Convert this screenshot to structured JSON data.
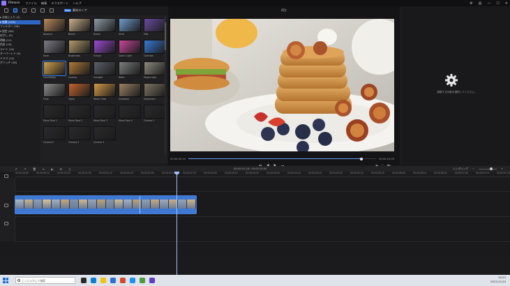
{
  "window": {
    "app_name": "Filmora",
    "menu": [
      "ファイル",
      "編集",
      "エクスポート",
      "ヘルプ"
    ],
    "controls": [
      "⚙",
      "▤",
      "—",
      "☐",
      "✕"
    ]
  },
  "toolbar": {
    "store_badge": "New",
    "store_label": "素材ストア"
  },
  "sidebar": {
    "items": [
      {
        "label": "▸ お気に入り (0)"
      },
      {
        "label": "▾ 効果 (124)"
      },
      {
        "label": "   フィルター (58)"
      },
      {
        "label": "  ▾ 設定 (64)"
      },
      {
        "label": "     ぼかし (5)"
      },
      {
        "label": "     明暗 (11)"
      },
      {
        "label": "     色彩 (19)"
      },
      {
        "label": "     ライト (10)"
      },
      {
        "label": "     オーバーレイ (9)"
      },
      {
        "label": "     ドラマ (12)"
      },
      {
        "label": "     グリッチ (16)"
      }
    ]
  },
  "gallery": {
    "items": [
      {
        "label": "Balance",
        "color": "#b78a5a"
      },
      {
        "label": "Bokeh",
        "color": "#c9b08a"
      },
      {
        "label": "Bloom",
        "color": "#8d9aa3"
      },
      {
        "label": "Vivid",
        "color": "#6f9ccb"
      },
      {
        "label": "Mist",
        "color": "#6a4aa0"
      },
      {
        "label": "Haze",
        "color": "#7b7d86"
      },
      {
        "label": "Brightness",
        "color": "#b49a6c"
      },
      {
        "label": "Crayon",
        "color": "#9b4bd0"
      },
      {
        "label": "Comic Light",
        "color": "#c8489b"
      },
      {
        "label": "Contrast",
        "color": "#3a79d6"
      },
      {
        "label": "Countdown",
        "color": "#d2a24a"
      },
      {
        "label": "Cinema",
        "color": "#b07a3a"
      },
      {
        "label": "Sunlight",
        "color": "#5a606a"
      },
      {
        "label": "Retro",
        "color": "#7a7f7d"
      },
      {
        "label": "Faded Look",
        "color": "#8d8a7e"
      },
      {
        "label": "Frost",
        "color": "#8c8c8c"
      },
      {
        "label": "Sepia",
        "color": "#c3652e"
      },
      {
        "label": "Warm Glow",
        "color": "#d59a48"
      },
      {
        "label": "Sunbeam",
        "color": "#9a8262"
      },
      {
        "label": "Daydream",
        "color": "#7e7363"
      },
      {
        "label": "Mono Tone 1",
        "color": "#2a2a2c"
      },
      {
        "label": "Mono Tone 2",
        "color": "#2a2a2c"
      },
      {
        "label": "Mono Tone 3",
        "color": "#2a2a2c"
      },
      {
        "label": "Mono Tone 4",
        "color": "#2a2a2c"
      },
      {
        "label": "Cinema 1",
        "color": "#2a2a2c"
      },
      {
        "label": "Cinema 2",
        "color": "#2a2a2c"
      },
      {
        "label": "Cinema 3",
        "color": "#2a2a2c"
      },
      {
        "label": "Cinema 4",
        "color": "#2a2a2c"
      }
    ]
  },
  "preview": {
    "title": "再生",
    "time_current": "00:00:05:14",
    "time_total": "00:00:10:00",
    "progress": 0.92,
    "controls": [
      "⏮",
      "◀",
      "▶",
      "⏭"
    ],
    "right_controls": [
      "▣",
      "⛶",
      "📷"
    ]
  },
  "properties": {
    "empty_message": "調整する対象を選択してください。"
  },
  "timeline": {
    "tools": [
      "↶",
      "↷",
      "🗑",
      "✂",
      "◐",
      "⟳",
      "♫"
    ],
    "timecode": "00:00:01:18 / 00:00:10:00",
    "right_label": "レンダリング",
    "ruler": [
      "00:00:00:00",
      "00:00:00:10",
      "00:00:00:20",
      "00:00:01:00",
      "00:00:01:10",
      "00:00:01:20",
      "00:00:02:00",
      "00:00:02:10",
      "00:00:02:20",
      "00:00:03:00",
      "00:00:03:10",
      "00:00:03:20",
      "00:00:04:00",
      "00:00:04:10",
      "00:00:04:20",
      "00:00:05:00",
      "00:00:05:10",
      "00:00:05:20",
      "00:00:06:00",
      "00:00:06:10",
      "00:00:06:20",
      "00:00:07:00",
      "00:00:07:10",
      "00:00:07:20"
    ],
    "clip_label": "IMG_20"
  },
  "taskbar": {
    "search_placeholder": "ここに入力して検索",
    "time": "10:23",
    "date": "2021/11/10"
  }
}
